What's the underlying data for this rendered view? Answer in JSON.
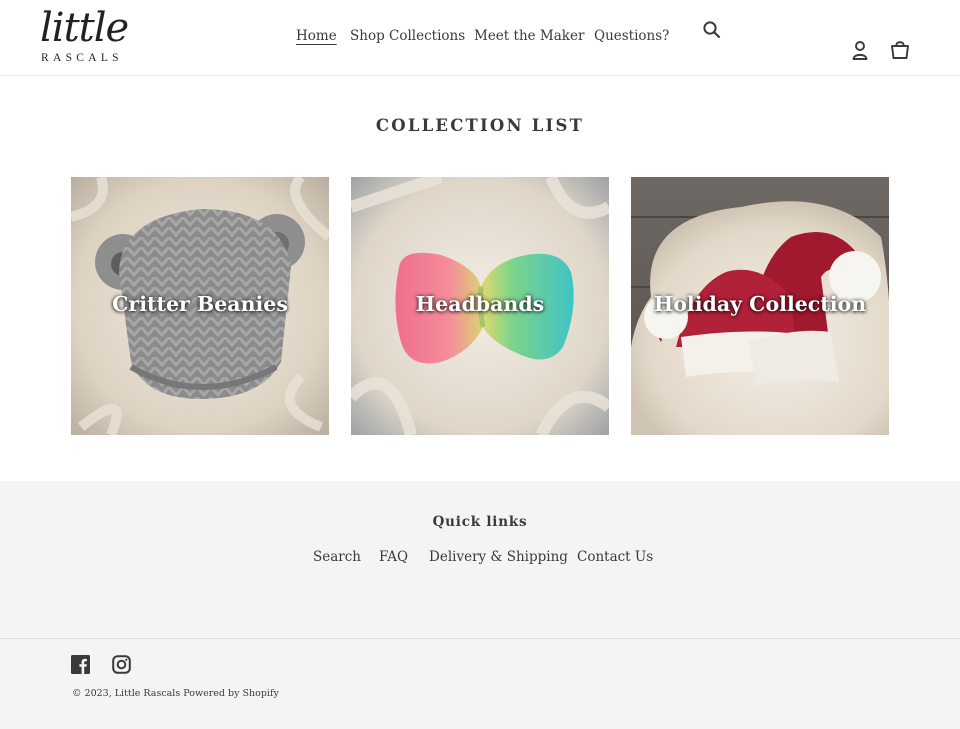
{
  "header": {
    "logo": {
      "script_text": "little",
      "sub_text": "RASCALS"
    },
    "nav": [
      {
        "label": "Home"
      },
      {
        "label": "Shop Collections"
      },
      {
        "label": "Meet the Maker"
      },
      {
        "label": "Questions?"
      }
    ],
    "icons": {
      "search": "search-icon",
      "account": "user-icon",
      "cart": "cart-icon"
    }
  },
  "main": {
    "title": "COLLECTION LIST",
    "collections": [
      {
        "label": "Critter Beanies"
      },
      {
        "label": "Headbands"
      },
      {
        "label": "Holiday Collection"
      }
    ]
  },
  "footer": {
    "quick_links_title": "Quick links",
    "links": [
      {
        "label": "Search"
      },
      {
        "label": "FAQ"
      },
      {
        "label": "Delivery & Shipping"
      },
      {
        "label": "Contact Us"
      }
    ],
    "social": [
      "facebook-icon",
      "instagram-icon"
    ],
    "copyright_prefix": "© 2023,",
    "shop_name": "Little Rascals",
    "powered_by": "Powered by Shopify"
  },
  "colors": {
    "text": "#3a3a3a",
    "footer_bg": "#f4f4f4",
    "card_label": "#ffffff"
  }
}
